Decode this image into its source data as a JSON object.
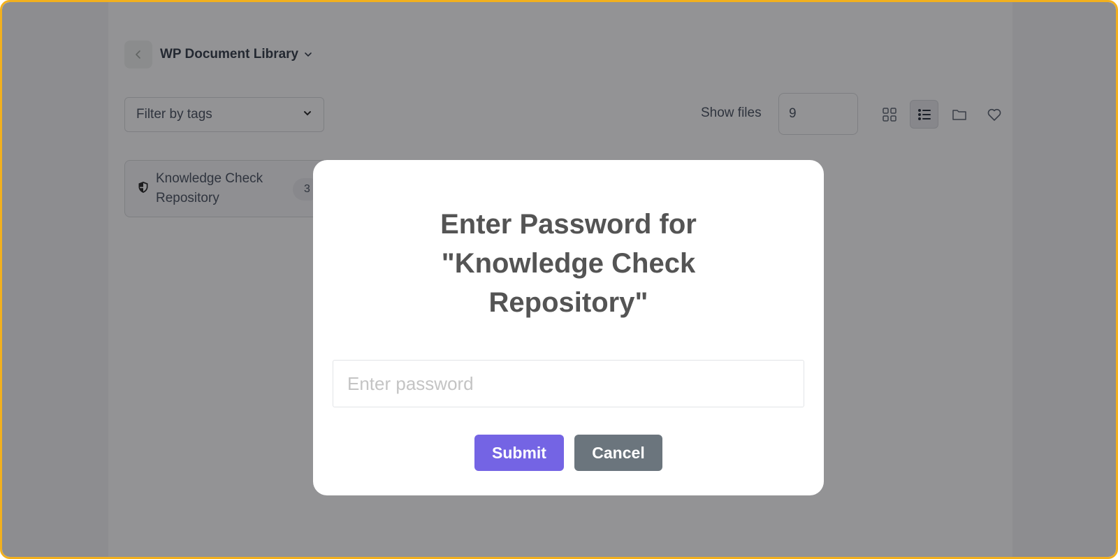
{
  "header": {
    "library_title": "WP Document Library"
  },
  "toolbar": {
    "filter_label": "Filter by tags",
    "show_files_label": "Show files",
    "show_files_value": "9"
  },
  "folders": [
    {
      "name": "Knowledge Check Repository",
      "count": "3"
    }
  ],
  "modal": {
    "title": "Enter Password for \"Knowledge Check Repository\"",
    "password_placeholder": "Enter password",
    "submit_label": "Submit",
    "cancel_label": "Cancel"
  },
  "colors": {
    "accent": "#7464e4",
    "cancel": "#6b757d",
    "frame_border": "#f2b01e"
  }
}
